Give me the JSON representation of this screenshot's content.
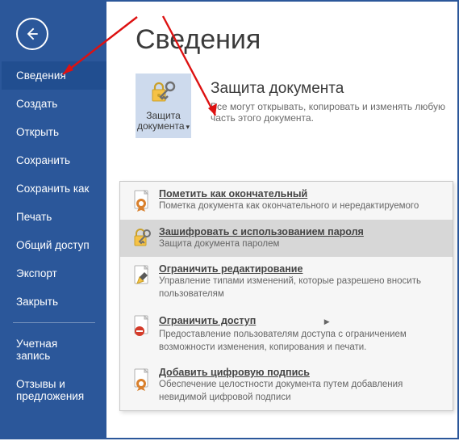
{
  "sidebar": {
    "items": [
      {
        "label": "Сведения",
        "selected": true
      },
      {
        "label": "Создать",
        "selected": false
      },
      {
        "label": "Открыть",
        "selected": false
      },
      {
        "label": "Сохранить",
        "selected": false
      },
      {
        "label": "Сохранить как",
        "selected": false
      },
      {
        "label": "Печать",
        "selected": false
      },
      {
        "label": "Общий доступ",
        "selected": false
      },
      {
        "label": "Экспорт",
        "selected": false
      },
      {
        "label": "Закрыть",
        "selected": false
      }
    ],
    "footer": [
      {
        "label": "Учетная запись"
      },
      {
        "label": "Отзывы и предложения"
      }
    ]
  },
  "main": {
    "title": "Сведения",
    "protect": {
      "button_line1": "Защита",
      "button_line2": "документа",
      "heading": "Защита документа",
      "desc": "Все могут открывать, копировать и изменять любую часть этого документа."
    }
  },
  "dropdown": [
    {
      "title": "Пометить как окончательный",
      "desc": "Пометка документа как окончательного и нередактируемого",
      "icon": "final",
      "highlight": false
    },
    {
      "title": "Зашифровать с использованием пароля",
      "desc": "Защита документа паролем",
      "icon": "encrypt",
      "highlight": true
    },
    {
      "title": "Ограничить редактирование",
      "desc": "Управление типами изменений, которые разрешено вносить пользователям",
      "icon": "restrict-edit",
      "highlight": false
    },
    {
      "title": "Ограничить доступ",
      "desc": "Предоставление пользователям доступа с ограничением возможности изменения, копирования и печати.",
      "icon": "restrict-access",
      "highlight": false
    },
    {
      "title": "Добавить цифровую подпись",
      "desc": "Обеспечение целостности документа путем добавления невидимой цифровой подписи",
      "icon": "signature",
      "highlight": false
    }
  ],
  "colors": {
    "brand": "#2b579a",
    "accent_yellow": "#f6c245",
    "award_orange": "#d9802d",
    "deny_red": "#d43b2a"
  }
}
